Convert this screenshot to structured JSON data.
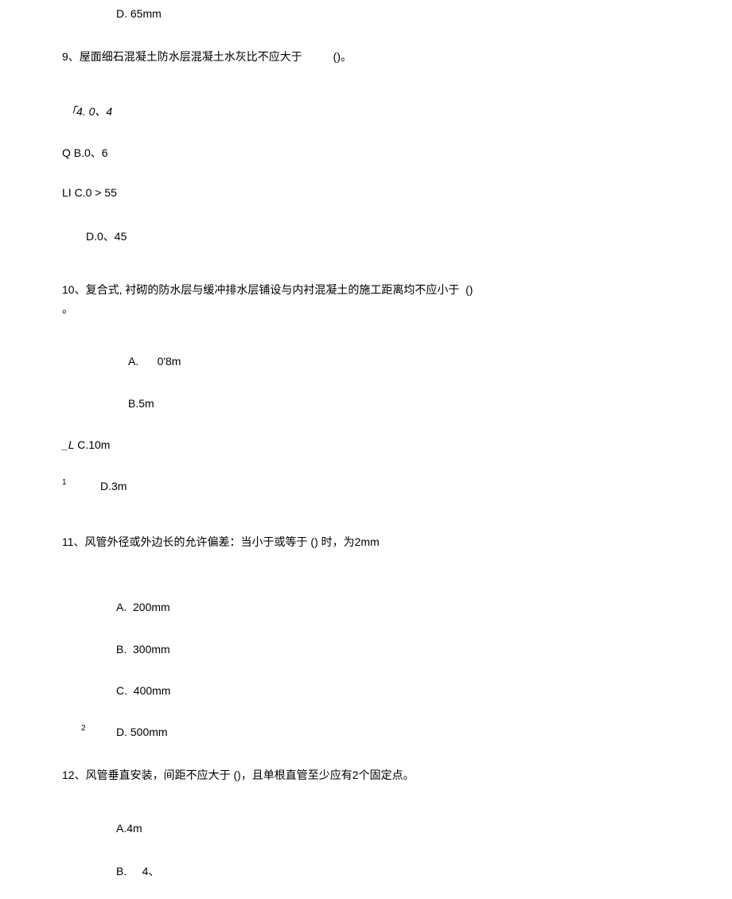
{
  "q8_optD": "D. 65mm",
  "q9": {
    "stem": "9、屋面细石混凝土防水层混凝土水灰比不应大于          ()。",
    "optA": "「4. 0、4",
    "optB": "Q B.0、6",
    "optC": "LI C.0 > 55",
    "optD": "D.0、45"
  },
  "q10": {
    "stem": "10、复合式, 衬砌的防水层与缓冲排水层铺设与内衬混凝土的施工距离均不应小于  ()",
    "stem_tail": "。",
    "optA": "A.      0'8m",
    "optB": "B.5m",
    "optC_prefix": "_L ",
    "optC": "C.10m",
    "optD_prefix": "1",
    "optD": "D.3m"
  },
  "q11": {
    "stem": "11、风管外径或外边长的允许偏差：当小于或等于 () 时，为2mm",
    "optA": "A.  200mm",
    "optB": "B.  300mm",
    "optC": "C.  400mm",
    "optD_prefix": "2",
    "optD": "D. 500mm"
  },
  "q12": {
    "stem": "12、风管垂直安装，间距不应大于 ()，且单根直管至少应有2个固定点。",
    "optA": "A.4m",
    "optB": "B.     4、"
  }
}
